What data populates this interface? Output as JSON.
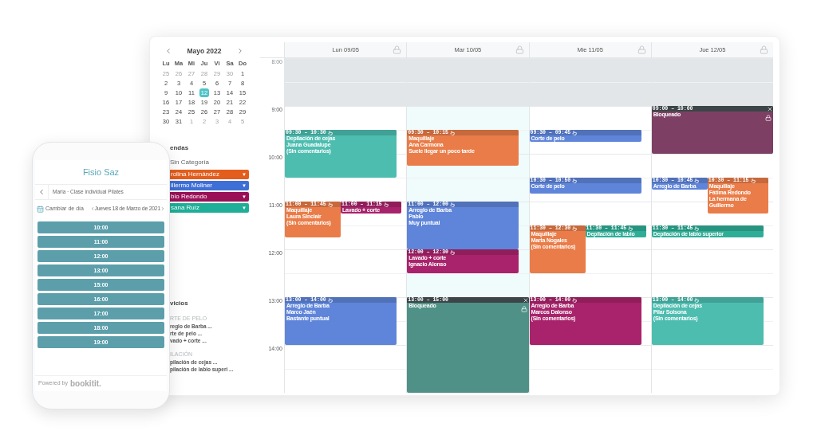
{
  "mini_calendar": {
    "month": "Mayo 2022",
    "weekdays": [
      "Lu",
      "Ma",
      "Mi",
      "Ju",
      "Vi",
      "Sa",
      "Do"
    ],
    "weeks": [
      [
        {
          "label": "25",
          "muted": true,
          "selected": false
        },
        {
          "label": "26",
          "muted": true,
          "selected": false
        },
        {
          "label": "27",
          "muted": true,
          "selected": false
        },
        {
          "label": "28",
          "muted": true,
          "selected": false
        },
        {
          "label": "29",
          "muted": true,
          "selected": false
        },
        {
          "label": "30",
          "muted": true,
          "selected": false
        },
        {
          "label": "1",
          "muted": false,
          "selected": false
        }
      ],
      [
        {
          "label": "2",
          "muted": false,
          "selected": false
        },
        {
          "label": "3",
          "muted": false,
          "selected": false
        },
        {
          "label": "4",
          "muted": false,
          "selected": false
        },
        {
          "label": "5",
          "muted": false,
          "selected": false
        },
        {
          "label": "6",
          "muted": false,
          "selected": false
        },
        {
          "label": "7",
          "muted": false,
          "selected": false
        },
        {
          "label": "8",
          "muted": false,
          "selected": false
        }
      ],
      [
        {
          "label": "9",
          "muted": false,
          "selected": false
        },
        {
          "label": "10",
          "muted": false,
          "selected": false
        },
        {
          "label": "11",
          "muted": false,
          "selected": false
        },
        {
          "label": "12",
          "muted": false,
          "selected": true
        },
        {
          "label": "13",
          "muted": false,
          "selected": false
        },
        {
          "label": "14",
          "muted": false,
          "selected": false
        },
        {
          "label": "15",
          "muted": false,
          "selected": false
        }
      ],
      [
        {
          "label": "16",
          "muted": false,
          "selected": false
        },
        {
          "label": "17",
          "muted": false,
          "selected": false
        },
        {
          "label": "18",
          "muted": false,
          "selected": false
        },
        {
          "label": "19",
          "muted": false,
          "selected": false
        },
        {
          "label": "20",
          "muted": false,
          "selected": false
        },
        {
          "label": "21",
          "muted": false,
          "selected": false
        },
        {
          "label": "22",
          "muted": false,
          "selected": false
        }
      ],
      [
        {
          "label": "23",
          "muted": false,
          "selected": false
        },
        {
          "label": "24",
          "muted": false,
          "selected": false
        },
        {
          "label": "25",
          "muted": false,
          "selected": false
        },
        {
          "label": "26",
          "muted": false,
          "selected": false
        },
        {
          "label": "27",
          "muted": false,
          "selected": false
        },
        {
          "label": "28",
          "muted": false,
          "selected": false
        },
        {
          "label": "29",
          "muted": false,
          "selected": false
        }
      ],
      [
        {
          "label": "30",
          "muted": false,
          "selected": false
        },
        {
          "label": "31",
          "muted": false,
          "selected": false
        },
        {
          "label": "1",
          "muted": true,
          "selected": false
        },
        {
          "label": "2",
          "muted": true,
          "selected": false
        },
        {
          "label": "3",
          "muted": true,
          "selected": false
        },
        {
          "label": "4",
          "muted": true,
          "selected": false
        },
        {
          "label": "5",
          "muted": true,
          "selected": false
        }
      ]
    ]
  },
  "agendas": {
    "title": "endas",
    "uncategorized": "Sin Categoría",
    "items": [
      {
        "label": "rolina Hernández",
        "color": "#e35d1c",
        "arrow": "▼"
      },
      {
        "label": "illermo Moliner",
        "color": "#3e6fd6",
        "arrow": "▼"
      },
      {
        "label": "blo Redondo",
        "color": "#9a1158",
        "arrow": "▼"
      },
      {
        "label": "sana Ruíz",
        "color": "#1fae98",
        "arrow": "▼"
      }
    ]
  },
  "services": {
    "title": "vicios",
    "groups": [
      {
        "name": "RTE DE PELO",
        "items": [
          "reglo de Barba ...",
          "rte de pelo ...",
          "vado + corte ..."
        ]
      },
      {
        "name": "ILACIÓN",
        "items": [
          "pilación de cejas ...",
          "pilación de labio superi ..."
        ]
      }
    ]
  },
  "hours": [
    {
      "label": "8:00",
      "closed": true
    },
    {
      "label": "9:00",
      "closed": false
    },
    {
      "label": "10:00",
      "closed": false
    },
    {
      "label": "11:00",
      "closed": false
    },
    {
      "label": "12:00",
      "closed": false
    },
    {
      "label": "13:00",
      "closed": false
    },
    {
      "label": "14:00",
      "closed": false
    }
  ],
  "days": [
    {
      "label": "Lun 09/05",
      "highlighted": false,
      "events": [
        {
          "kind": "appointment",
          "color": "#4dbdb0",
          "time": "09:30 – 10:30",
          "lines": [
            "Depilación de cejas",
            "Juana Guadalupe",
            "(Sin comentarios)"
          ]
        },
        {
          "kind": "appointment",
          "color": "#e97c48",
          "time": "11:00 – 11:45",
          "lines": [
            "Maquillaje",
            "Laura Sinclair",
            "(Sin comentarios)"
          ]
        },
        {
          "kind": "appointment",
          "color": "#a8236b",
          "time": "11:00 – 11:15",
          "lines": [
            "Lavado + corte"
          ]
        },
        {
          "kind": "appointment",
          "color": "#5f85da",
          "time": "13:00 – 14:00",
          "lines": [
            "Arreglo de Barba",
            "Marco Jaén",
            "Bastante puntual"
          ]
        }
      ]
    },
    {
      "label": "Mar 10/05",
      "highlighted": true,
      "events": [
        {
          "kind": "appointment",
          "color": "#e97c48",
          "time": "09:30 – 10:15",
          "lines": [
            "Maquillaje",
            "Ana Carmona",
            "Suele llegar un poco tarde"
          ]
        },
        {
          "kind": "appointment",
          "color": "#5f85da",
          "time": "11:00 – 12:00",
          "lines": [
            "Arreglo de Barba",
            "Pablo",
            "Muy puntual"
          ]
        },
        {
          "kind": "appointment",
          "color": "#a8236b",
          "time": "12:00 – 12:30",
          "lines": [
            "Lavado + corte",
            "Ignacio Alonso"
          ]
        },
        {
          "kind": "blocked",
          "color": "#4f9186",
          "time": "13:00 – 15:00",
          "lines": [
            "Bloqueado"
          ]
        }
      ]
    },
    {
      "label": "Mie 11/05",
      "highlighted": false,
      "events": [
        {
          "kind": "appointment",
          "color": "#5f85da",
          "time": "09:30 – 09:45",
          "lines": [
            "Corte de pelo"
          ]
        },
        {
          "kind": "appointment",
          "color": "#5f85da",
          "time": "10:30 – 10:50",
          "lines": [
            "Corte de pelo"
          ]
        },
        {
          "kind": "appointment",
          "color": "#e97c48",
          "time": "11:30 – 12:30",
          "lines": [
            "Maquillaje",
            "Marta Nogales",
            "(Sin comentarios)"
          ]
        },
        {
          "kind": "appointment",
          "color": "#2fae97",
          "time": "11:30 – 11:45",
          "lines": [
            "Depilación de labio"
          ]
        },
        {
          "kind": "appointment",
          "color": "#a8236b",
          "time": "13:00 – 14:00",
          "lines": [
            "Arreglo de Barba",
            "Marcos Dalonso",
            "(Sin comentarios)"
          ]
        }
      ]
    },
    {
      "label": "Jue 12/05",
      "highlighted": false,
      "events": [
        {
          "kind": "blocked",
          "color": "#7d4064",
          "time": "09:00 – 10:00",
          "lines": [
            "Bloqueado"
          ]
        },
        {
          "kind": "appointment",
          "color": "#5f85da",
          "time": "10:30 – 10:45",
          "lines": [
            "Arreglo de Barba"
          ]
        },
        {
          "kind": "appointment",
          "color": "#e97c48",
          "time": "10:30 – 11:15",
          "lines": [
            "Maquillaje",
            "Fátima Redondo",
            "La hermana de Guillermo"
          ]
        },
        {
          "kind": "appointment",
          "color": "#2fae97",
          "time": "11:30 – 11:45",
          "lines": [
            "Depilación de labio superior"
          ]
        },
        {
          "kind": "appointment",
          "color": "#4dbdb0",
          "time": "13:00 – 14:00",
          "lines": [
            "Depilación de cejas",
            "Pilar Solsona",
            "(Sin comentarios)"
          ]
        }
      ]
    }
  ],
  "phone": {
    "title": "Fisio Saz",
    "service": "Maria · Clase individual Pilates",
    "change_day": "Cambiar de día",
    "date": "Jueves 18 de Marzo de 2021",
    "slots": [
      "10:00",
      "11:00",
      "12:00",
      "13:00",
      "15:00",
      "16:00",
      "17:00",
      "18:00",
      "19:00"
    ],
    "powered_by": "Powered by",
    "brand": "bookitit."
  }
}
